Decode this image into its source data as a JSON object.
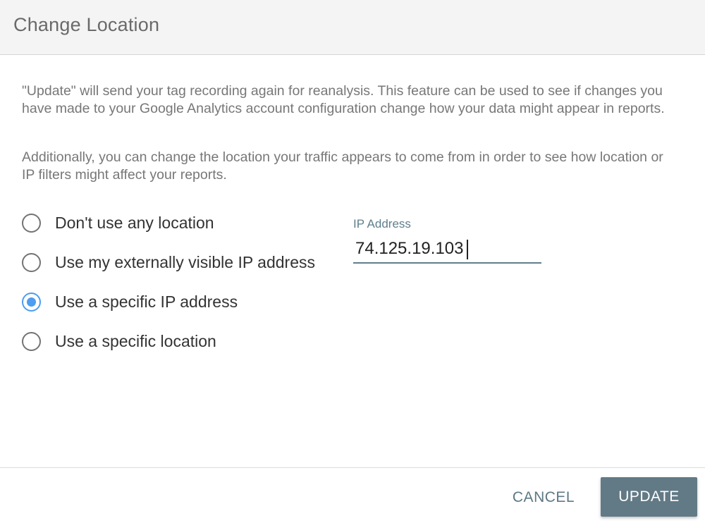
{
  "dialog": {
    "title": "Change Location"
  },
  "description": {
    "paragraph_1": "\"Update\" will send your tag recording again for reanalysis. This feature can be used to see if changes you have made to your Google Analytics account configuration change how your data might appear in reports.",
    "paragraph_2": "Additionally, you can change the location your traffic appears to come from in order to see how location or IP filters might affect your reports."
  },
  "location_options": [
    {
      "label": "Don't use any location",
      "selected": false
    },
    {
      "label": "Use my externally visible IP address",
      "selected": false
    },
    {
      "label": "Use a specific IP address",
      "selected": true
    },
    {
      "label": "Use a specific location",
      "selected": false
    }
  ],
  "ip_field": {
    "label": "IP Address",
    "value": "74.125.19.103"
  },
  "footer": {
    "cancel_label": "CANCEL",
    "update_label": "UPDATE"
  },
  "colors": {
    "accent_radio": "#4d9df0",
    "primary_button": "#627a86",
    "header_background": "#f4f4f4"
  }
}
